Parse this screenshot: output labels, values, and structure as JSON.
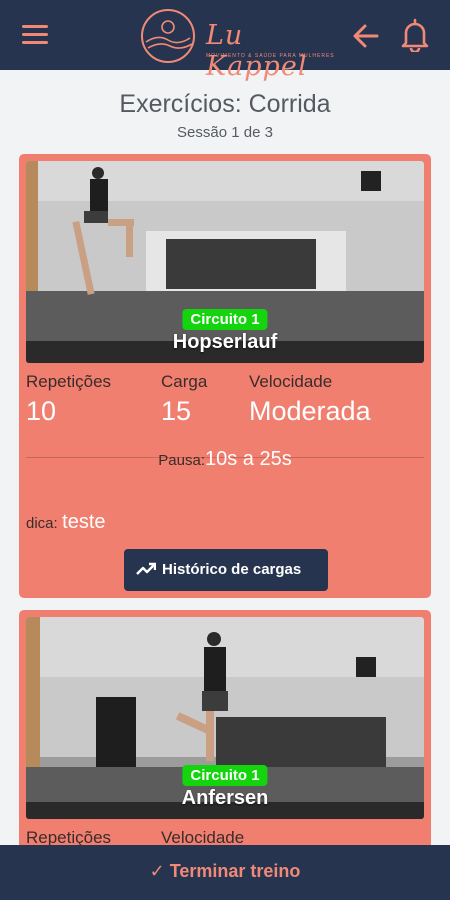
{
  "header": {
    "logo_name": "Lu Kappel",
    "logo_tagline": "MOVIMENTO & SAÚDE PARA MULHERES",
    "icons": [
      "menu-icon",
      "arrow-left-icon",
      "bell-icon"
    ],
    "accent_color": "#f08a76",
    "bar_color": "#263450"
  },
  "page": {
    "title": "Exercícios: Corrida",
    "subtitle": "Sessão 1 de 3"
  },
  "exercises": [
    {
      "circuit": "Circuito 1",
      "name": "Hopserlauf",
      "labels": {
        "reps": "Repetições",
        "load": "Carga",
        "speed": "Velocidade"
      },
      "reps": "10",
      "load": "15",
      "speed": "Moderada",
      "pause_label": "Pausa:",
      "pause": "10s a 25s",
      "tip_label": "dica:",
      "tip": "teste",
      "history_button": "Histórico de cargas"
    },
    {
      "circuit": "Circuito 1",
      "name": "Anfersen",
      "labels": {
        "reps": "Repetições",
        "speed": "Velocidade"
      }
    }
  ],
  "footer": {
    "finish_button": "✓ Terminar treino"
  },
  "colors": {
    "card": "#f07f70",
    "badge": "#14d40e",
    "background": "#f2f3f5"
  }
}
